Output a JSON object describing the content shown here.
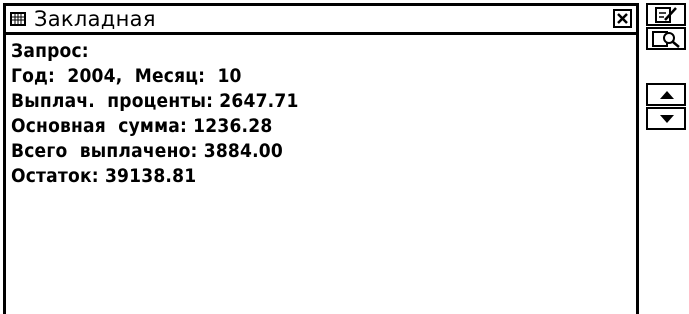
{
  "window": {
    "title": "Закладная",
    "title_icon": "grid-icon",
    "close_icon": "close-icon"
  },
  "content": {
    "lines": [
      "Запрос:",
      "Год:  2004,  Месяц:  10",
      "Выплач.  проценты: 2647.71",
      "Основная  сумма: 1236.28",
      "Всего  выплачено: 3884.00",
      "Остаток: 39138.81"
    ]
  },
  "sidebar": {
    "buttons": [
      {
        "icon": "edit-icon"
      },
      {
        "icon": "search-icon"
      },
      {
        "icon": "arrow-up-icon"
      },
      {
        "icon": "arrow-down-icon"
      }
    ]
  }
}
